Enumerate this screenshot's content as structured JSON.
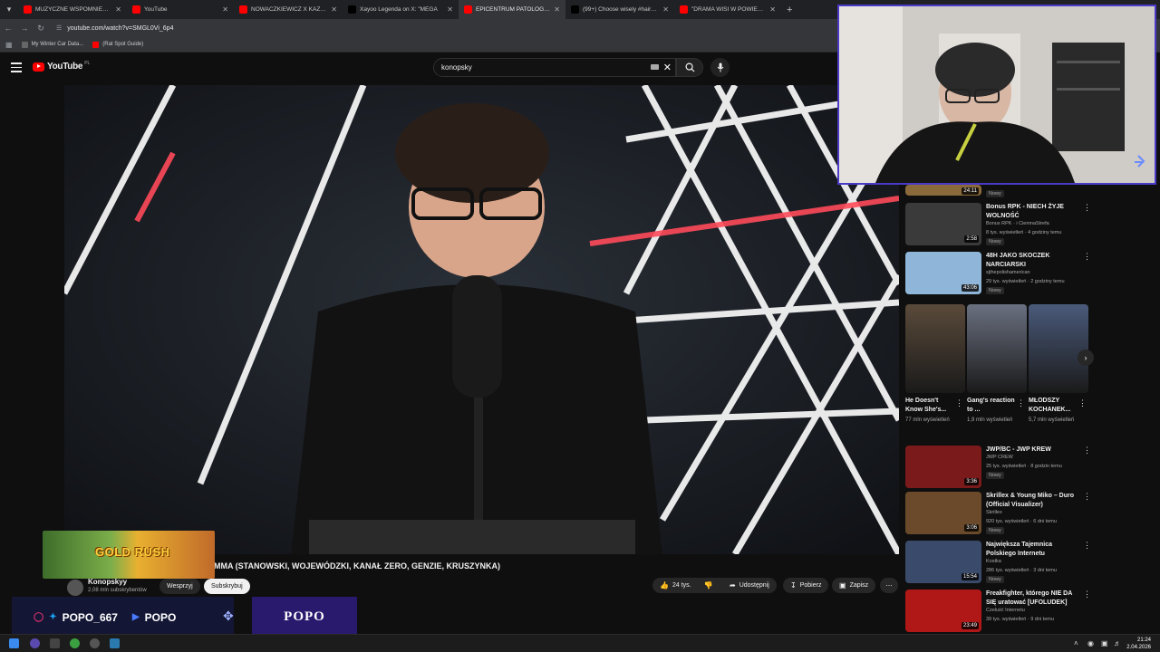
{
  "browser": {
    "tabs": [
      {
        "title": "MUZYCZNE WSPOMNIENIA KL",
        "favicon_color": "#ff0000",
        "active": false
      },
      {
        "title": "YouTube",
        "favicon_color": "#ff0000",
        "active": false
      },
      {
        "title": "NOWACZKIEWICZ X KAZIOR",
        "favicon_color": "#ff0000",
        "active": false
      },
      {
        "title": "Xayoo Legenda on X: \"MEGA",
        "favicon_color": "#000000",
        "active": false
      },
      {
        "title": "EPICENTRUM PATOLOGII W",
        "favicon_color": "#ff0000",
        "active": true
      },
      {
        "title": "(99+) Choose wisely #haircut #",
        "favicon_color": "#000000",
        "active": false
      },
      {
        "title": "\"DRAMA WISI W POWIETRZU\"",
        "favicon_color": "#ff0000",
        "active": false
      }
    ],
    "url": "youtube.com/watch?v=SMGL0Vi_6p4",
    "bookmarks": [
      {
        "label": "My Winter Car Data..."
      },
      {
        "label": "(Rat Spot Guide)"
      }
    ]
  },
  "youtube": {
    "logo_text": "YouTube",
    "region": "PL",
    "search_value": "konopsky",
    "video_title_visible": "MMA (STANOWSKI, WOJEWÓDZKI, KANAŁ ZERO, GENZIE, KRUSZYNKA)",
    "channel": {
      "name": "Konopskyy",
      "subs": "2,08 mln subskrybentów"
    },
    "buttons": {
      "support": "Wesprzyj",
      "subscribe": "Subskrybuj",
      "likes": "24 tys.",
      "share": "Udostępnij",
      "download": "Pobierz",
      "save": "Zapisz"
    }
  },
  "overlay": {
    "game_banner": "GOLD RUSH",
    "social_handle": "POPO_667",
    "yt_handle": "POPO",
    "brand": "POPO"
  },
  "sidebar": {
    "top_partial": {
      "duration": "24:11",
      "badge": "Nowy"
    },
    "items": [
      {
        "title": "Bonus RPK - NIECH ŻYJE WOLNOŚĆ",
        "channel": "Bonus RPK · i CiemnaStrefa",
        "meta": "8 tys. wyświetleń · 4 godziny temu",
        "badge": "Nowy",
        "duration": "2:58",
        "thumb": "#3a3a3a"
      },
      {
        "title": "48H JAKO SKOCZEK NARCIARSKI",
        "channel": "sjthepolishamerican",
        "meta": "29 tys. wyświetleń · 2 godziny temu",
        "badge": "Nowy",
        "duration": "43:06",
        "thumb": "#8fb6d8"
      }
    ],
    "shorts": [
      {
        "title": "He Doesn't Know She's...",
        "views": "77 mln wyświetleń",
        "thumb": "#5a4a3a"
      },
      {
        "title": "Gang's reaction to ...",
        "views": "1,9 mln wyświetleń",
        "thumb": "#6a7080"
      },
      {
        "title": "MŁODSZY KOCHANEK...",
        "views": "5,7 mln wyświetleń",
        "thumb": "#4a5a7a"
      }
    ],
    "items2": [
      {
        "title": "JWP/BC - JWP KREW",
        "channel": "JWP CREW",
        "meta": "25 tys. wyświetleń · 8 godzin temu",
        "badge": "Nowy",
        "duration": "3:36",
        "thumb": "#7a1a1a"
      },
      {
        "title": "Skrillex & Young Miko – Duro (Official Visualizer)",
        "channel": "Skrillex",
        "meta": "920 tys. wyświetleń · 6 dni temu",
        "badge": "Nowy",
        "duration": "3:06",
        "thumb": "#6a4a2a"
      },
      {
        "title": "Największa Tajemnica Polskiego Internetu",
        "channel": "Kostka",
        "meta": "286 tys. wyświetleń · 3 dni temu",
        "badge": "Nowy",
        "duration": "15:54",
        "thumb": "#3a4a6a"
      },
      {
        "title": "Freakfighter, którego NIE DA SIĘ uratować [UFOLUDEK]",
        "channel": "Czeluść Internetu",
        "meta": "39 tys. wyświetleń · 9 dni temu",
        "badge": "",
        "duration": "23:49",
        "thumb": "#b01818"
      }
    ]
  },
  "taskbar": {
    "time": "21:24",
    "date": "2.04.2026"
  }
}
